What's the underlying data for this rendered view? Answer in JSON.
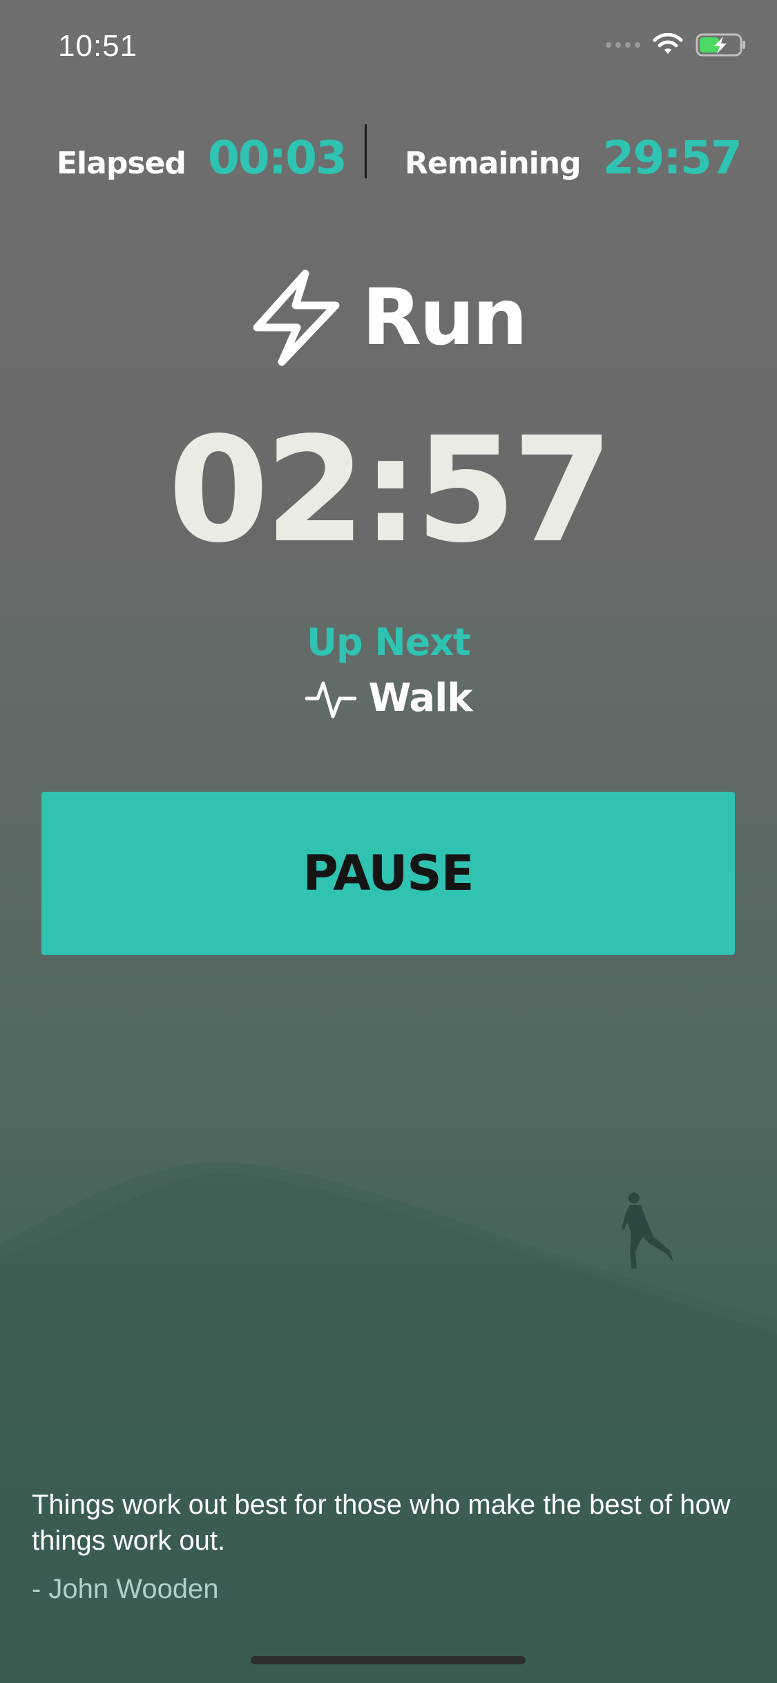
{
  "status_bar": {
    "time": "10:51"
  },
  "stats": {
    "elapsed_label": "Elapsed",
    "elapsed_value": "00:03",
    "remaining_label": "Remaining",
    "remaining_value": "29:57"
  },
  "current_interval": {
    "icon": "lightning-bolt-icon",
    "name": "Run",
    "countdown": "02:57"
  },
  "up_next": {
    "label": "Up Next",
    "icon": "pulse-icon",
    "name": "Walk"
  },
  "controls": {
    "pause_label": "PAUSE"
  },
  "quote": {
    "text": "Things work out best for those who make the best of how things work out.",
    "author": "- John Wooden"
  },
  "colors": {
    "accent": "#2fc3b2",
    "countdown": "#e9ece2",
    "button_text": "#141414"
  }
}
